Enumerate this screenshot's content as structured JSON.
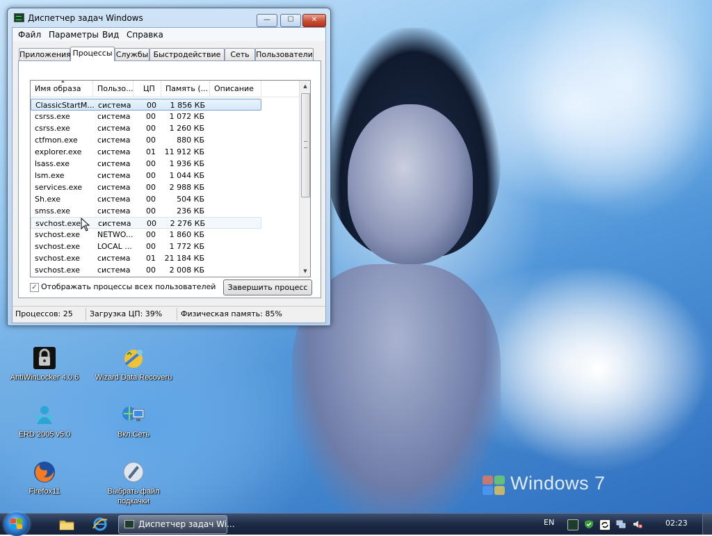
{
  "window": {
    "title": "Диспетчер задач Windows",
    "minimize_glyph": "—",
    "maximize_glyph": "☐",
    "close_glyph": "✕"
  },
  "menu": [
    "Файл",
    "Параметры",
    "Вид",
    "Справка"
  ],
  "tabs": [
    "Приложения",
    "Процессы",
    "Службы",
    "Быстродействие",
    "Сеть",
    "Пользователи"
  ],
  "active_tab": "Процессы",
  "columns": [
    "Имя образа",
    "Пользо...",
    "ЦП",
    "Память (...",
    "Описание"
  ],
  "processes": [
    {
      "name": "ClassicStartM...",
      "user": "система",
      "cpu": "00",
      "mem": "1 856 КБ"
    },
    {
      "name": "csrss.exe",
      "user": "система",
      "cpu": "00",
      "mem": "1 072 КБ"
    },
    {
      "name": "csrss.exe",
      "user": "система",
      "cpu": "00",
      "mem": "1 260 КБ"
    },
    {
      "name": "ctfmon.exe",
      "user": "система",
      "cpu": "00",
      "mem": "880 КБ"
    },
    {
      "name": "explorer.exe",
      "user": "система",
      "cpu": "01",
      "mem": "11 912 КБ"
    },
    {
      "name": "lsass.exe",
      "user": "система",
      "cpu": "00",
      "mem": "1 936 КБ"
    },
    {
      "name": "lsm.exe",
      "user": "система",
      "cpu": "00",
      "mem": "1 044 КБ"
    },
    {
      "name": "services.exe",
      "user": "система",
      "cpu": "00",
      "mem": "2 988 КБ"
    },
    {
      "name": "Sh.exe",
      "user": "система",
      "cpu": "00",
      "mem": "504 КБ"
    },
    {
      "name": "smss.exe",
      "user": "система",
      "cpu": "00",
      "mem": "236 КБ"
    },
    {
      "name": "svchost.exe",
      "user": "система",
      "cpu": "00",
      "mem": "2 276 КБ"
    },
    {
      "name": "svchost.exe",
      "user": "NETWO...",
      "cpu": "00",
      "mem": "1 860 КБ"
    },
    {
      "name": "svchost.exe",
      "user": "LOCAL ...",
      "cpu": "00",
      "mem": "1 772 КБ"
    },
    {
      "name": "svchost.exe",
      "user": "система",
      "cpu": "01",
      "mem": "21 184 КБ"
    },
    {
      "name": "svchost.exe",
      "user": "система",
      "cpu": "00",
      "mem": "2 008 КБ"
    }
  ],
  "selected_row": 0,
  "hover_row": 10,
  "show_all_checkbox": {
    "label": "Отображать процессы всех пользователей",
    "checked": true,
    "check_glyph": "✓"
  },
  "end_process_button": "Завершить процесс",
  "status": {
    "processes": "Процессов: 25",
    "cpu": "Загрузка ЦП: 39%",
    "memory": "Физическая память: 85%"
  },
  "desktop_icons": [
    {
      "label": "AntiWinLocker 4.0.6",
      "icon": "padlock-icon"
    },
    {
      "label": "Wizard Data Recoveru",
      "icon": "wizard-icon"
    },
    {
      "label": "ERD 2005 v5.0",
      "icon": "erd-icon"
    },
    {
      "label": "Вкл.Сеть",
      "icon": "network-icon"
    },
    {
      "label": "Firefox11",
      "icon": "firefox-icon"
    },
    {
      "label": "Выбрать файл подкачки",
      "icon": "pagefile-icon"
    }
  ],
  "wallpaper_brand": "Windows 7",
  "taskbar": {
    "task_label": "Диспетчер задач Wi...",
    "language": "EN",
    "clock": "02:23"
  },
  "colors": {
    "selection": "#d6e9fb",
    "selection_border": "#7da2ce",
    "taskbar": "#1c2a44",
    "close_button": "#c74e35"
  }
}
